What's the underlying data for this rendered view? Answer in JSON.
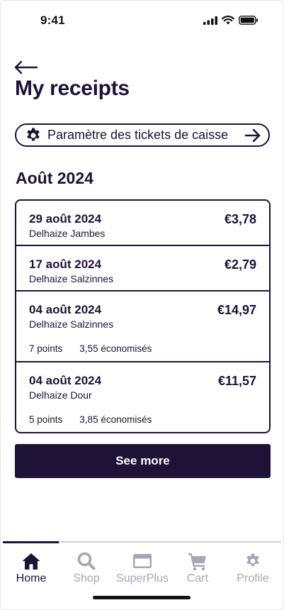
{
  "status_bar": {
    "time": "9:41"
  },
  "header": {
    "title": "My receipts"
  },
  "settings": {
    "label": "Paramètre des tickets de caisse"
  },
  "month": {
    "title": "Août 2024"
  },
  "receipts": [
    {
      "date": "29 août 2024",
      "store": "Delhaize Jambes",
      "amount": "€3,78"
    },
    {
      "date": "17 août 2024",
      "store": "Delhaize Salzinnes",
      "amount": "€2,79"
    },
    {
      "date": "04 août 2024",
      "store": "Delhaize Salzinnes",
      "amount": "€14,97",
      "points": "7 points",
      "saved": "3,55 économisés"
    },
    {
      "date": "04 août 2024",
      "store": "Delhaize Dour",
      "amount": "€11,57",
      "points": "5 points",
      "saved": "3,85 économisés"
    }
  ],
  "see_more": {
    "label": "See more"
  },
  "tabbar": {
    "items": [
      {
        "label": "Home",
        "icon": "home-icon",
        "active": true
      },
      {
        "label": "Shop",
        "icon": "search-icon",
        "active": false
      },
      {
        "label": "SuperPlus",
        "icon": "card-icon",
        "active": false
      },
      {
        "label": "Cart",
        "icon": "cart-icon",
        "active": false
      },
      {
        "label": "Profile",
        "icon": "gear-icon",
        "active": false
      }
    ]
  },
  "colors": {
    "primary": "#1e1236",
    "inactive": "#a8a6b6",
    "background": "#ffffff"
  }
}
